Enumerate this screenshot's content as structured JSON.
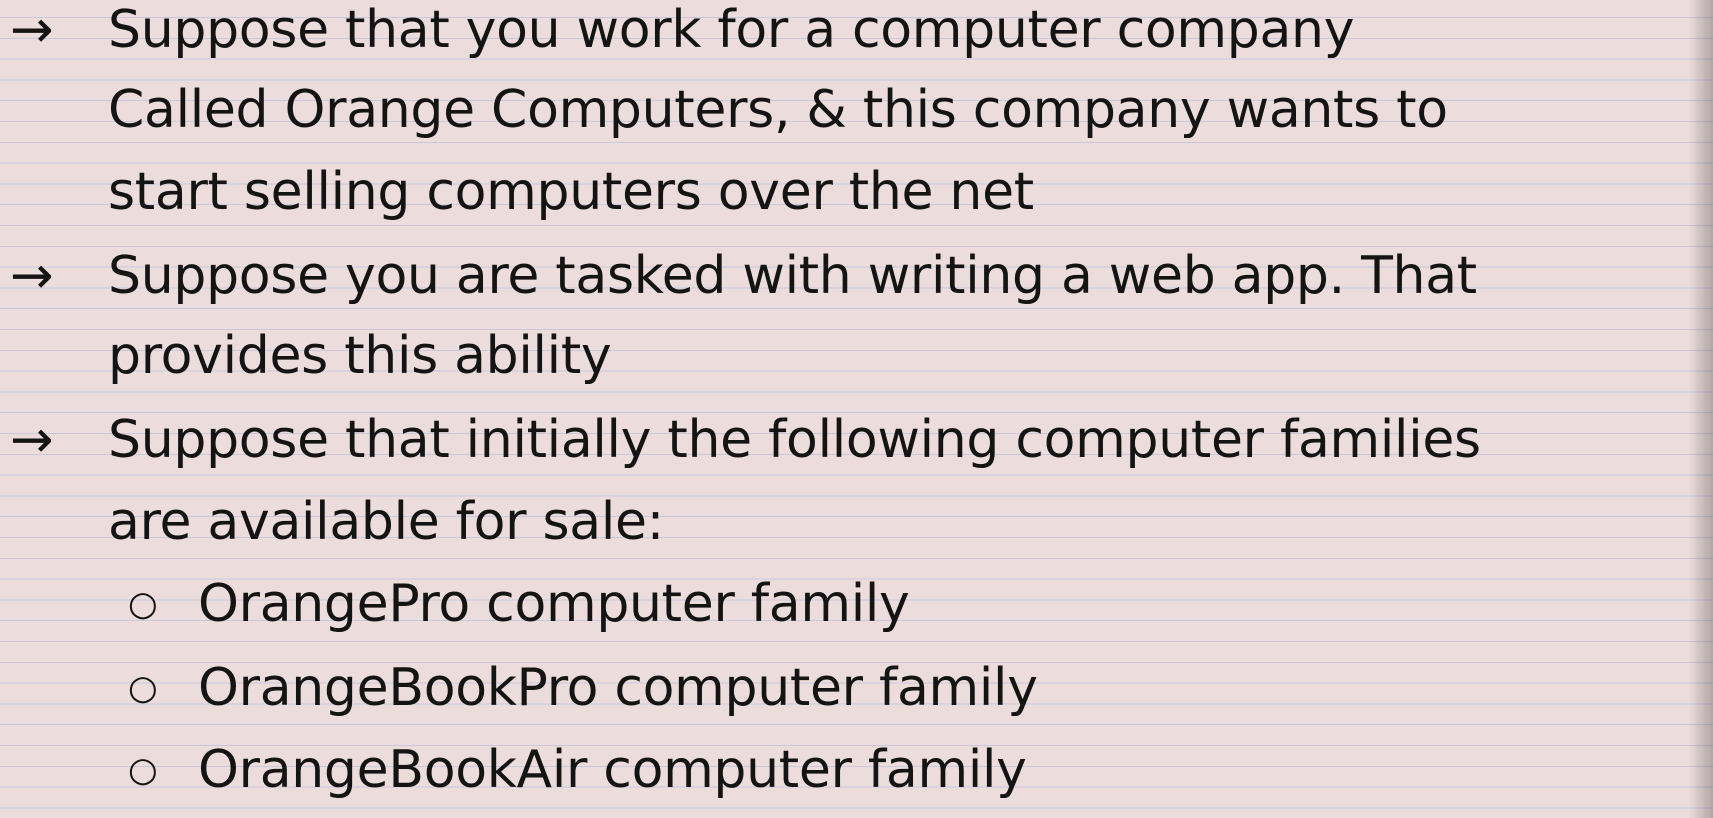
{
  "bullets": [
    {
      "marker": "→",
      "lines": [
        "Suppose that you work for a computer company",
        "Called Orange Computers, & this company wants to",
        "start selling computers over the net"
      ]
    },
    {
      "marker": "→",
      "lines": [
        "Suppose you are tasked with writing a web app. That",
        "provides this ability"
      ]
    },
    {
      "marker": "→",
      "lines": [
        "Suppose that initially the following computer families",
        "are available for sale:"
      ]
    }
  ],
  "sub_bullets": [
    {
      "marker": "○",
      "text": "OrangePro computer family"
    },
    {
      "marker": "○",
      "text": "OrangeBookPro computer family"
    },
    {
      "marker": "○",
      "text": "OrangeBookAir computer family"
    }
  ]
}
